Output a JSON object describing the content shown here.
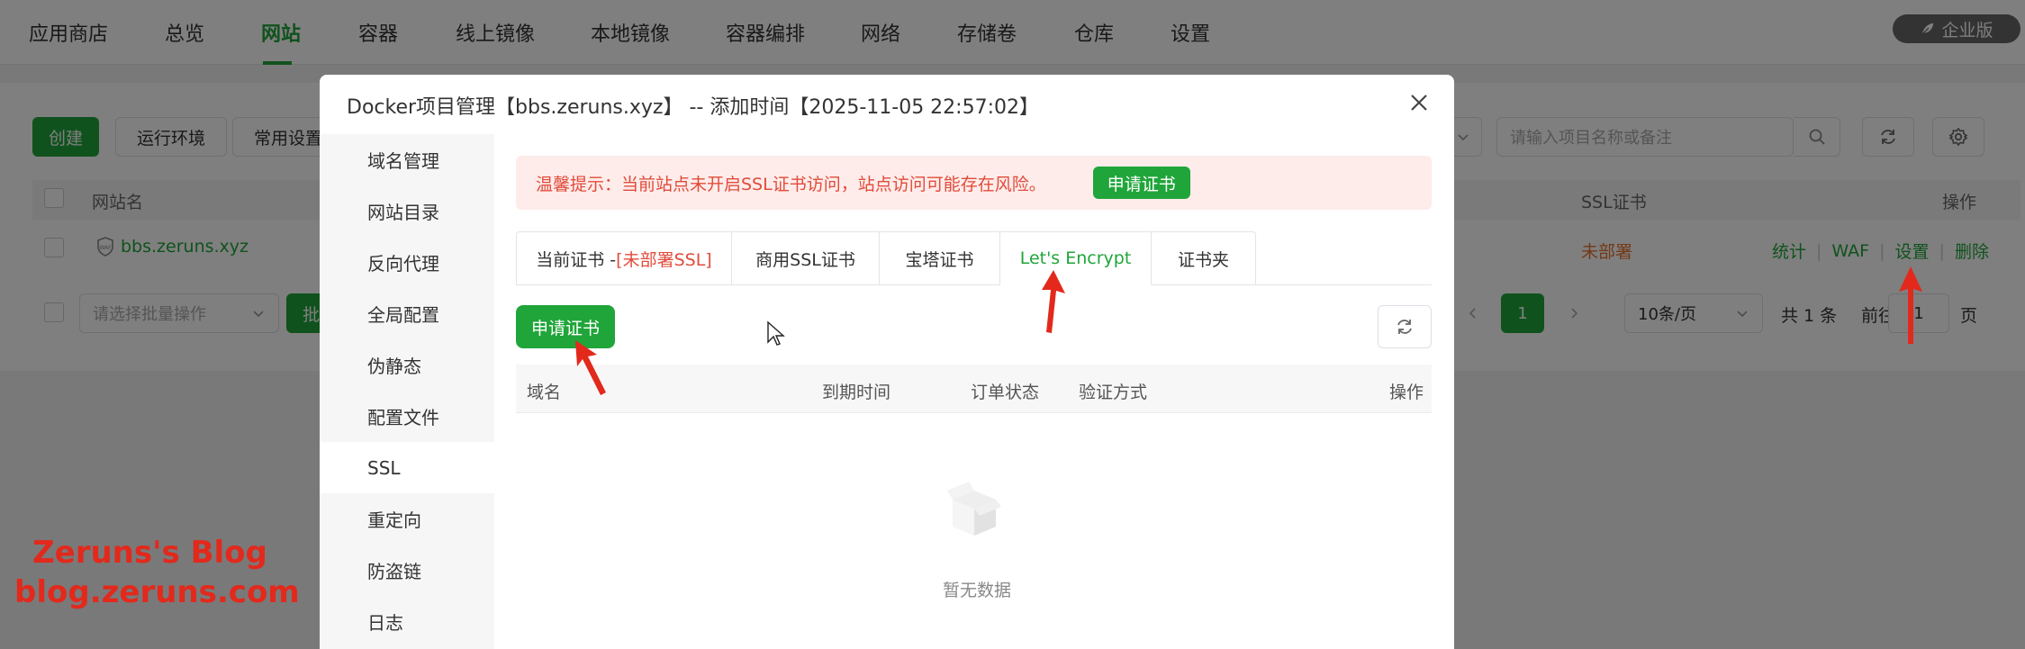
{
  "nav": {
    "items": [
      "应用商店",
      "总览",
      "网站",
      "容器",
      "线上镜像",
      "本地镜像",
      "容器编排",
      "网络",
      "存储卷",
      "仓库",
      "设置"
    ],
    "active_index": 2,
    "enterprise_label": "企业版"
  },
  "toolbar": {
    "create_label": "创建",
    "runtime_label": "运行环境",
    "common_settings_label": "常用设置",
    "search_placeholder": "请输入项目名称或备注"
  },
  "table": {
    "col_site": "网站名",
    "col_ssl": "SSL证书",
    "col_ops": "操作",
    "row": {
      "site": "bbs.zeruns.xyz",
      "ssl_status": "未部署",
      "ops": [
        "统计",
        "WAF",
        "设置",
        "删除"
      ]
    }
  },
  "footer": {
    "batch_placeholder": "请选择批量操作",
    "batch_button": "批",
    "current_page": "1",
    "page_size": "10条/页",
    "total": "共 1 条",
    "goto": "前往",
    "goto_value": "1",
    "page_unit": "页"
  },
  "dialog": {
    "title": "Docker项目管理【bbs.zeruns.xyz】 -- 添加时间【2025-11-05 22:57:02】",
    "sidebar": [
      "域名管理",
      "网站目录",
      "反向代理",
      "全局配置",
      "伪静态",
      "配置文件",
      "SSL",
      "重定向",
      "防盗链",
      "日志"
    ],
    "active_side_index": 6,
    "warning_text": "温馨提示：当前站点未开启SSL证书访问，站点访问可能存在风险。",
    "warning_button": "申请证书",
    "tabs": {
      "current_prefix": "当前证书 -",
      "current_status": "[未部署SSL]",
      "commercial": "商用SSL证书",
      "baota": "宝塔证书",
      "letsencrypt": "Let's Encrypt",
      "folder": "证书夹"
    },
    "apply_button": "申请证书",
    "grid_headers": {
      "domain": "域名",
      "expire": "到期时间",
      "order_status": "订单状态",
      "verify": "验证方式",
      "ops": "操作"
    },
    "empty_text": "暂无数据"
  },
  "watermark": {
    "line1": "Zeruns's Blog",
    "line2": "blog.zeruns.com"
  },
  "colors": {
    "brand_green": "#20a53a",
    "warning_red": "#e24b3a",
    "annotation_red": "#e2291c",
    "status_orange": "#e6722f"
  }
}
